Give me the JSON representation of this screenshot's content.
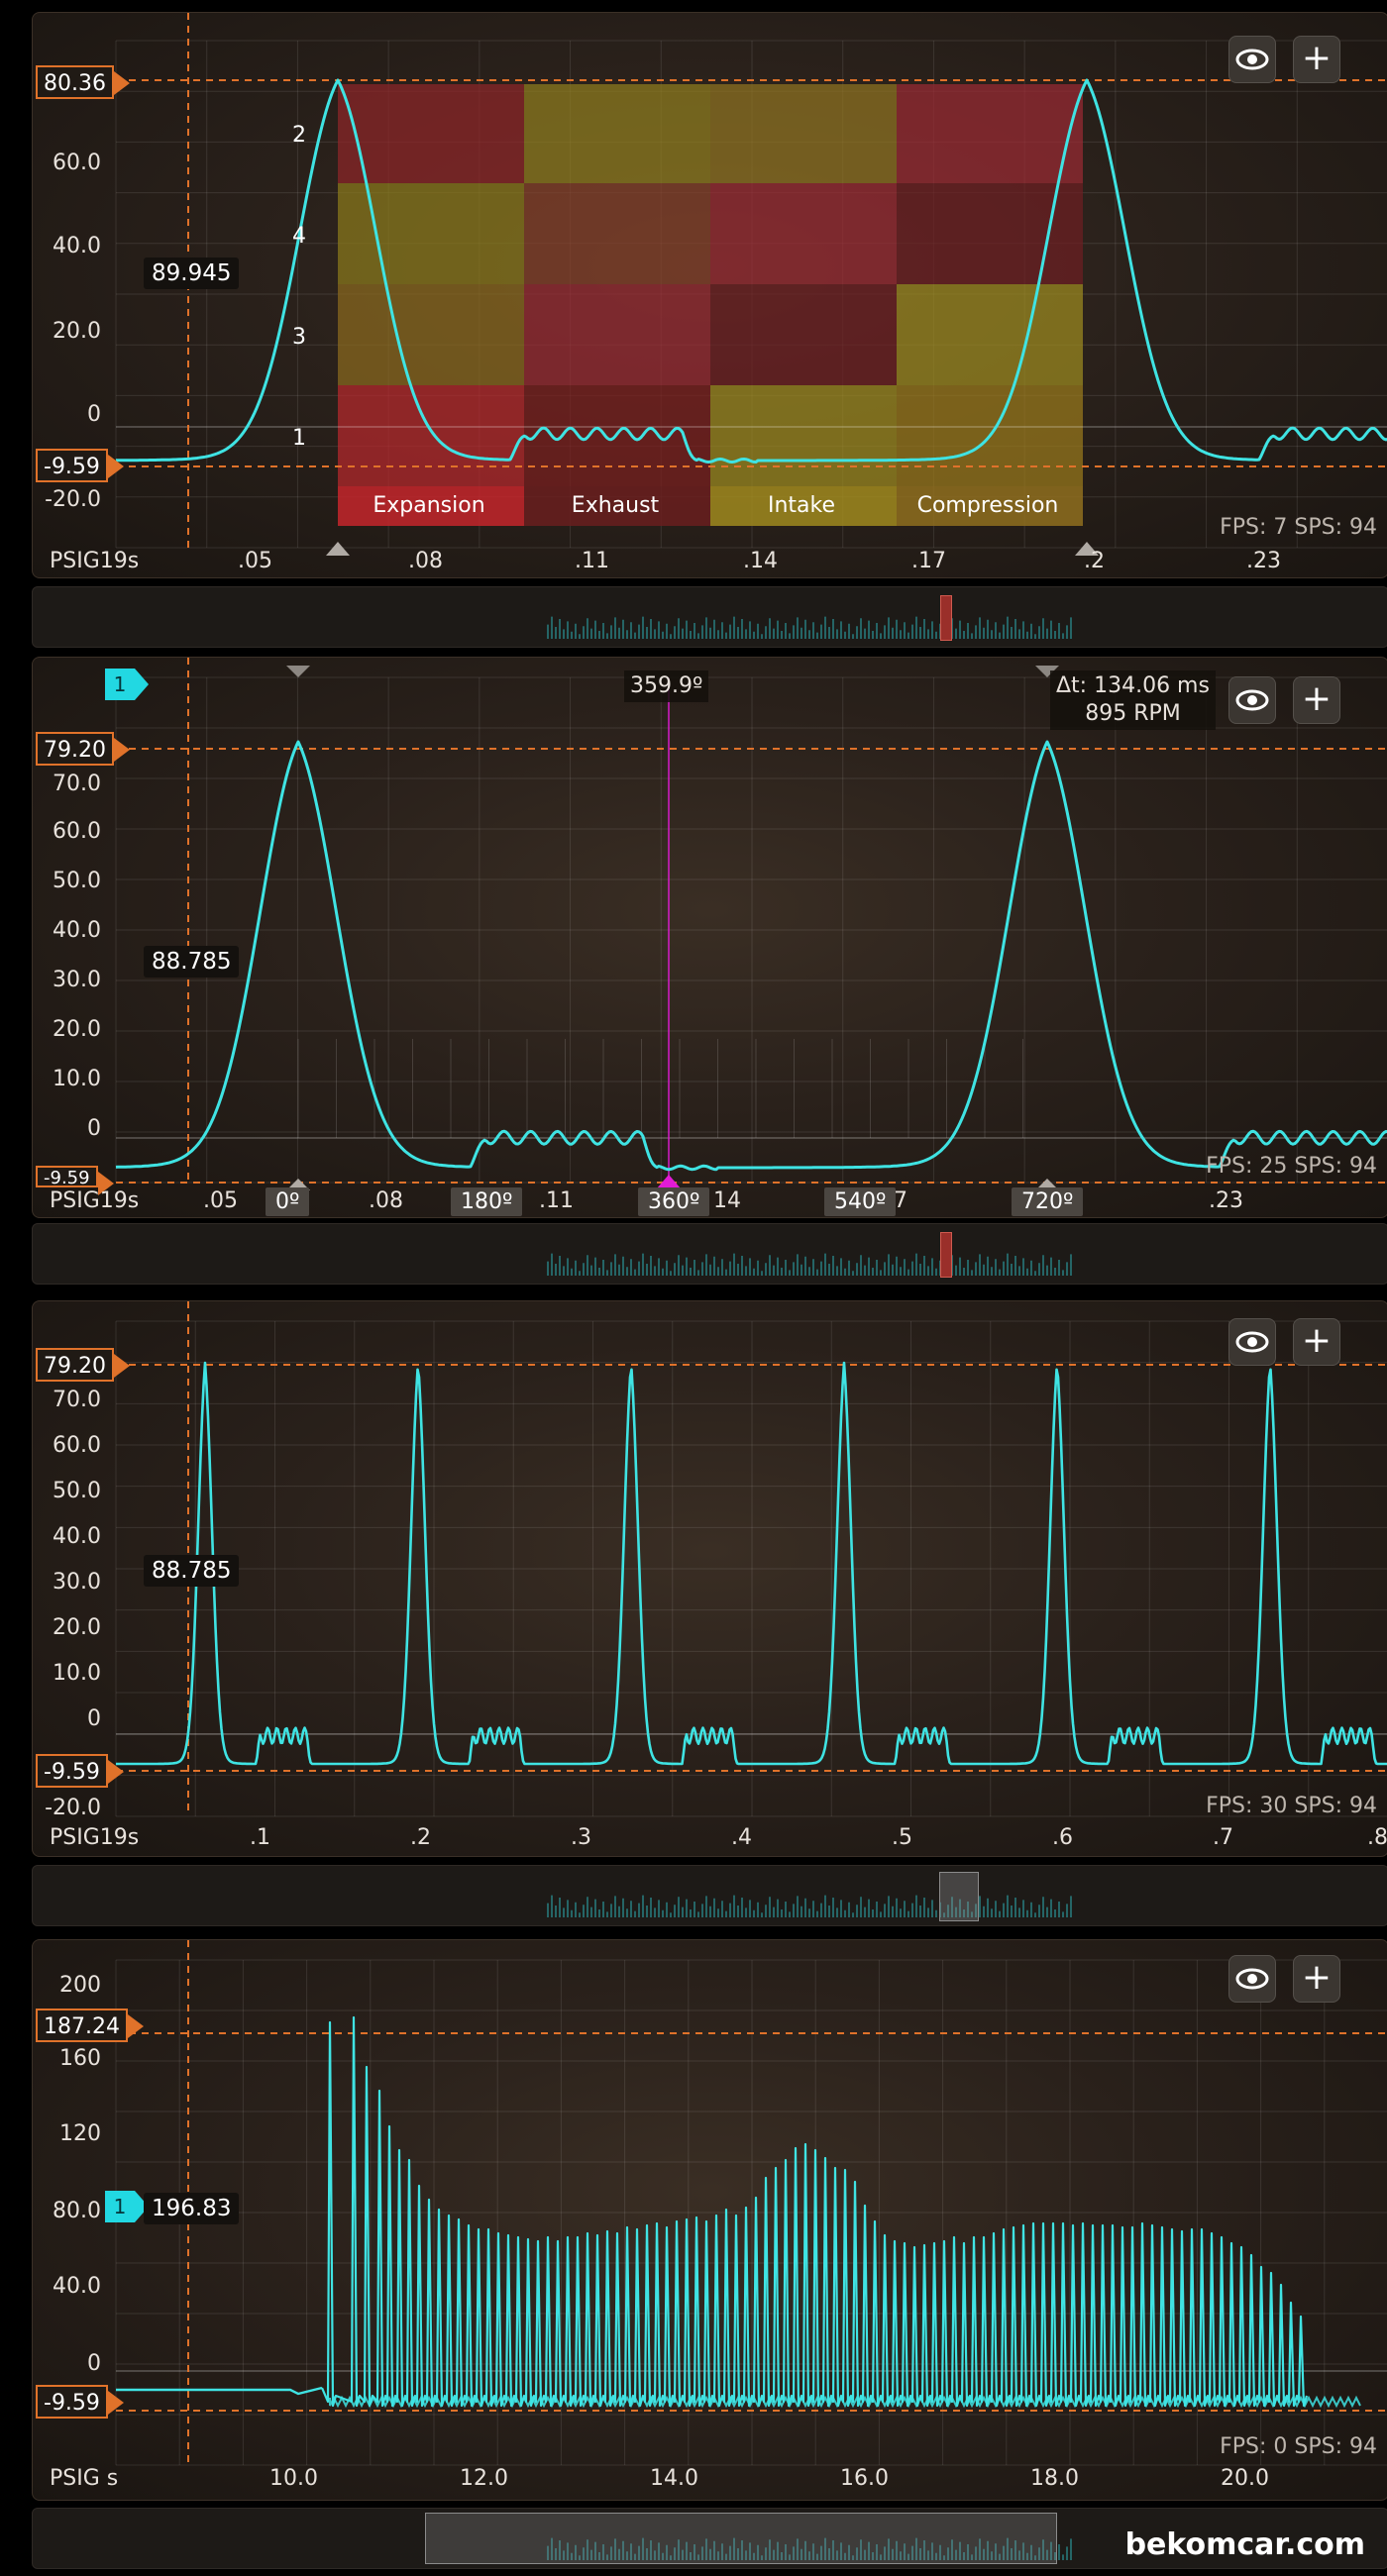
{
  "panel1": {
    "marker_top": "80.36",
    "marker_bottom": "-9.59",
    "cursor_value": "89.945",
    "yticks": [
      "60.0",
      "40.0",
      "20.0",
      "0",
      "-20.0"
    ],
    "unit": "PSIG",
    "xunit": "19s",
    "xticks": [
      ".05",
      ".08",
      ".11",
      ".14",
      ".17",
      ".2",
      ".23"
    ],
    "cylinders": [
      "2",
      "4",
      "3",
      "1"
    ],
    "strokes": [
      "Expansion",
      "Exhaust",
      "Intake",
      "Compression"
    ],
    "fps": "FPS: 7  SPS: 94"
  },
  "panel2": {
    "channel": "1",
    "marker_top": "79.20",
    "marker_bottom": "-9.59",
    "cursor_value": "88.785",
    "yticks": [
      "70.0",
      "60.0",
      "50.0",
      "40.0",
      "30.0",
      "20.0",
      "10.0",
      "0"
    ],
    "unit": "PSIG",
    "xunit": "19s",
    "xticks": [
      ".05",
      ".08",
      ".11",
      "14",
      "7",
      ".23"
    ],
    "degrees": [
      "0º",
      "180º",
      "360º",
      "540º",
      "720º"
    ],
    "cursor_angle": "359.9º",
    "delta_t": "Δt: 134.06 ms",
    "rpm": "895 RPM",
    "fps": "FPS: 25  SPS: 94"
  },
  "panel3": {
    "marker_top": "79.20",
    "marker_bottom": "-9.59",
    "cursor_value": "88.785",
    "yticks": [
      "70.0",
      "60.0",
      "50.0",
      "40.0",
      "30.0",
      "20.0",
      "10.0",
      "0",
      "-20.0"
    ],
    "unit": "PSIG",
    "xunit": "19s",
    "xticks": [
      ".1",
      ".2",
      ".3",
      ".4",
      ".5",
      ".6",
      ".7",
      ".8"
    ],
    "fps": "FPS: 30  SPS: 94"
  },
  "panel4": {
    "channel": "1",
    "marker_top": "187.24",
    "marker_bottom": "-9.59",
    "cursor_value": "196.83",
    "yticks": [
      "200",
      "160",
      "120",
      "80.0",
      "40.0",
      "0"
    ],
    "unit": "PSIG",
    "xunit": "s",
    "xticks": [
      "10.0",
      "12.0",
      "14.0",
      "16.0",
      "18.0",
      "20.0"
    ],
    "fps": "FPS: 0  SPS: 94"
  },
  "colors": {
    "trace": "#3fe3e3",
    "accent": "#e0722a",
    "magenta": "#e21bd6"
  },
  "icons": {
    "eye": "eye-icon",
    "plus": "plus-icon"
  },
  "watermark": "bekomcar.com"
}
